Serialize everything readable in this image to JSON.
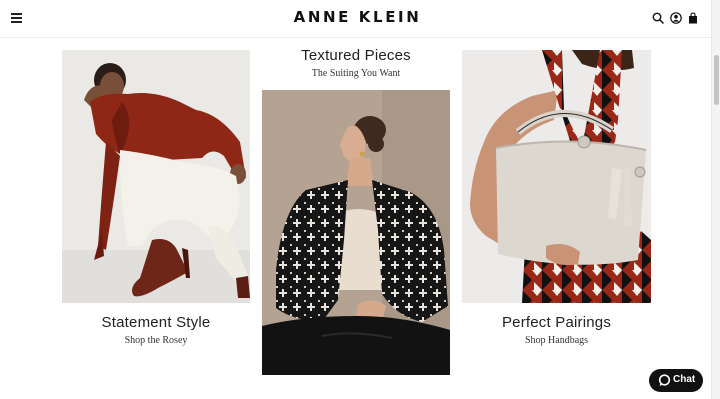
{
  "header": {
    "brand": "ANNE KLEIN",
    "icons": [
      "hamburger-menu-icon",
      "search-icon",
      "account-icon",
      "shopping-bag-icon"
    ]
  },
  "tiles": [
    {
      "title": "Statement Style",
      "subtitle": "Shop the Rosey"
    },
    {
      "title": "Textured Pieces",
      "subtitle": "The Suiting You Want"
    },
    {
      "title": "Perfect Pairings",
      "subtitle": "Shop Handbags"
    }
  ],
  "chat": {
    "label": "Chat",
    "icon": "chat-bubble-icon"
  },
  "colors": {
    "brand_text": "#111111",
    "chat_background": "#111111",
    "header_border": "#ececec"
  }
}
